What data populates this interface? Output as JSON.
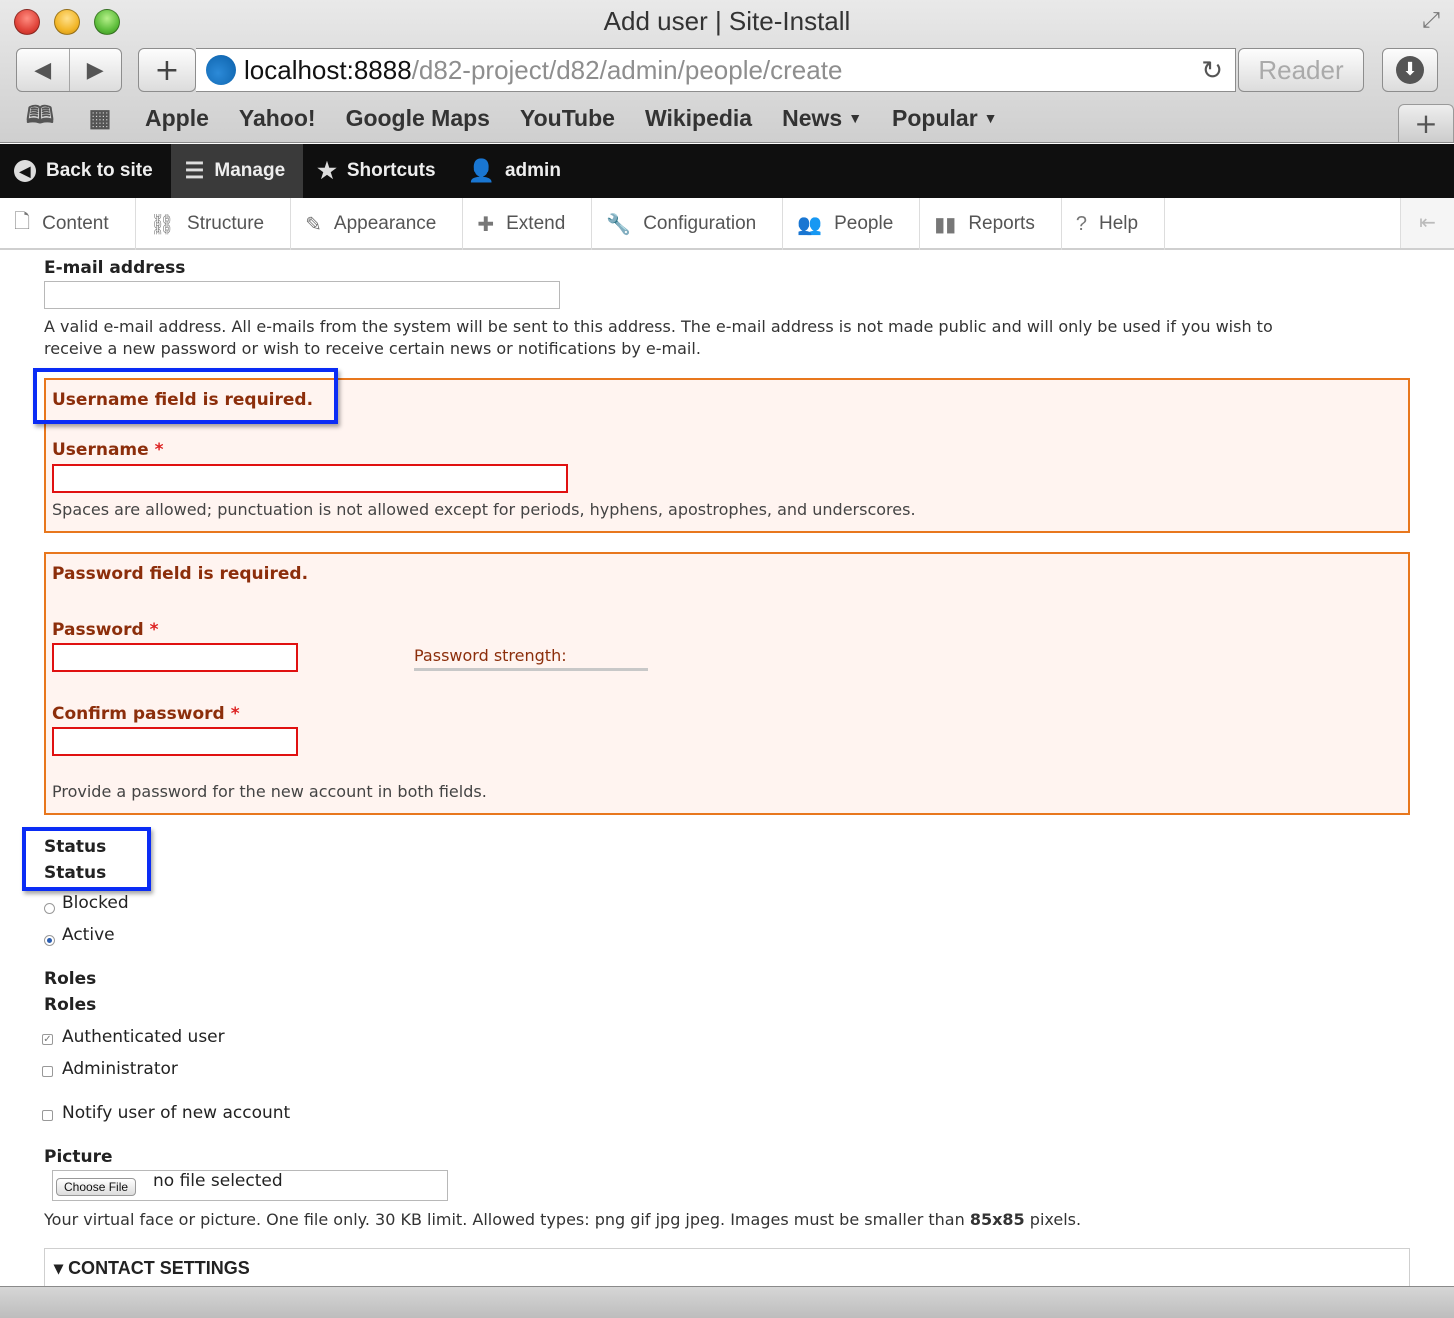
{
  "window": {
    "title": "Add user | Site-Install"
  },
  "browser": {
    "url_host": "localhost:8888",
    "url_path": "/d82-project/d82/admin/people/create",
    "reader_label": "Reader",
    "bookmarks": [
      "Apple",
      "Yahoo!",
      "Google Maps",
      "YouTube",
      "Wikipedia",
      "News",
      "Popular"
    ]
  },
  "toolbar": {
    "back_to_site": "Back to site",
    "manage": "Manage",
    "shortcuts": "Shortcuts",
    "user": "admin"
  },
  "admin_menu": [
    "Content",
    "Structure",
    "Appearance",
    "Extend",
    "Configuration",
    "People",
    "Reports",
    "Help"
  ],
  "form": {
    "email": {
      "label": "E-mail address",
      "value": "",
      "description_line1": "A valid e-mail address. All e-mails from the system will be sent to this address. The e-mail address is not made public and will only be used if you wish to",
      "description_line2": "receive a new password or wish to receive certain news or notifications by e-mail."
    },
    "username": {
      "error": "Username field is required.",
      "label": "Username",
      "required_mark": "*",
      "value": "",
      "description": "Spaces are allowed; punctuation is not allowed except for periods, hyphens, apostrophes, and underscores."
    },
    "password": {
      "error": "Password field is required.",
      "label": "Password",
      "required_mark": "*",
      "strength_label": "Password strength:",
      "confirm_label": "Confirm password",
      "description": "Provide a password for the new account in both fields."
    },
    "status": {
      "legend": "Status",
      "title": "Status",
      "options": [
        {
          "label": "Blocked",
          "selected": false
        },
        {
          "label": "Active",
          "selected": true
        }
      ]
    },
    "roles": {
      "legend": "Roles",
      "title": "Roles",
      "options": [
        {
          "label": "Authenticated user",
          "checked": true
        },
        {
          "label": "Administrator",
          "checked": false
        }
      ]
    },
    "notify": {
      "label": "Notify user of new account",
      "checked": false
    },
    "picture": {
      "label": "Picture",
      "button": "Choose File",
      "file_status": "no file selected",
      "description_prefix": "Your virtual face or picture. One file only. 30 KB limit. Allowed types: png gif jpg jpeg. Images must be smaller than",
      "description_size": "85x85",
      "description_suffix": "pixels."
    },
    "contact_settings": {
      "title": "CONTACT SETTINGS",
      "toggle": "▾"
    }
  },
  "colors": {
    "error_border": "#e8771d",
    "error_text": "#8c2e0b",
    "annotation_box": "#0a2cf5"
  }
}
